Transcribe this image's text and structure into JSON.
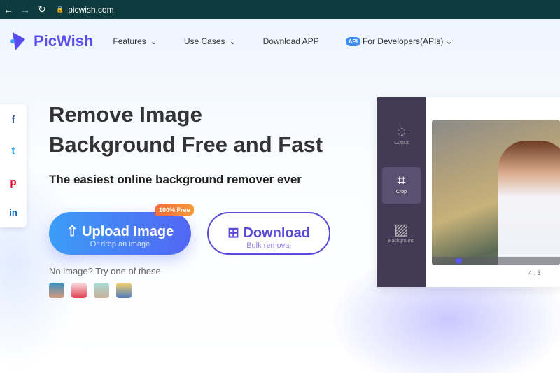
{
  "browser": {
    "url": "picwish.com"
  },
  "nav": {
    "brand": "PicWish",
    "items": [
      "Features",
      "Use Cases",
      "Download APP",
      "For Developers(APIs)"
    ],
    "api_badge": "API"
  },
  "hero": {
    "title_line1": "Remove Image",
    "title_line2": "Background Free and Fast",
    "subtitle": "The easiest online background remover ever",
    "upload": {
      "label": "Upload Image",
      "sub": "Or drop an image",
      "badge": "100% Free"
    },
    "download": {
      "label": "Download",
      "sub": "Bulk removal"
    },
    "no_image": "No image? Try one of these"
  },
  "share": [
    "f",
    "t",
    "p",
    "in"
  ],
  "editor": {
    "tools": [
      "Cutout",
      "Crop",
      "Background"
    ],
    "ratio": "4 : 3"
  }
}
